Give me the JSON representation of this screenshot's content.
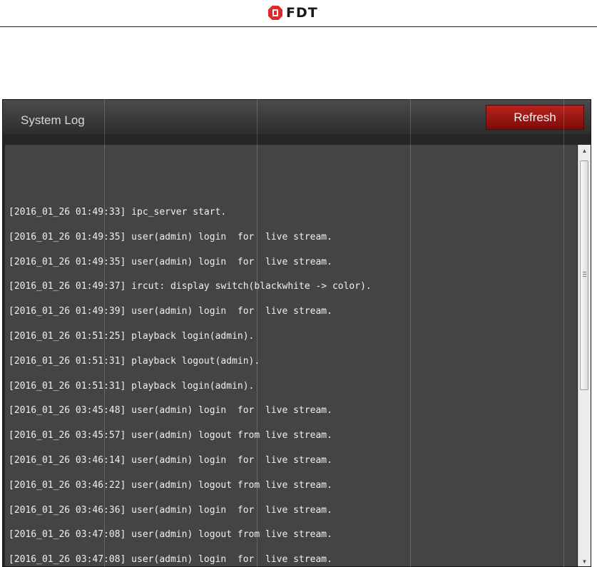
{
  "header": {
    "logo_text": "FDT",
    "logo_icon": "fdt-logo-icon",
    "brand_color": "#e3282b"
  },
  "panel": {
    "title": "System Log",
    "refresh_label": "Refresh",
    "accent_color": "#a11a15"
  },
  "log": {
    "lines": [
      "[2016_01_26 01:49:33] ipc_server start.",
      "[2016_01_26 01:49:35] user(admin) login  for  live stream.",
      "[2016_01_26 01:49:35] user(admin) login  for  live stream.",
      "[2016_01_26 01:49:37] ircut: display switch(blackwhite -> color).",
      "[2016_01_26 01:49:39] user(admin) login  for  live stream.",
      "[2016_01_26 01:51:25] playback login(admin).",
      "[2016_01_26 01:51:31] playback logout(admin).",
      "[2016_01_26 01:51:31] playback login(admin).",
      "[2016_01_26 03:45:48] user(admin) login  for  live stream.",
      "[2016_01_26 03:45:57] user(admin) logout from live stream.",
      "[2016_01_26 03:46:14] user(admin) login  for  live stream.",
      "[2016_01_26 03:46:22] user(admin) logout from live stream.",
      "[2016_01_26 03:46:36] user(admin) login  for  live stream.",
      "[2016_01_26 03:47:08] user(admin) logout from live stream.",
      "[2016_01_26 03:47:08] user(admin) login  for  live stream."
    ]
  },
  "scrollbar": {
    "up_icon": "scroll-up-arrow-icon",
    "down_icon": "scroll-down-arrow-icon"
  }
}
